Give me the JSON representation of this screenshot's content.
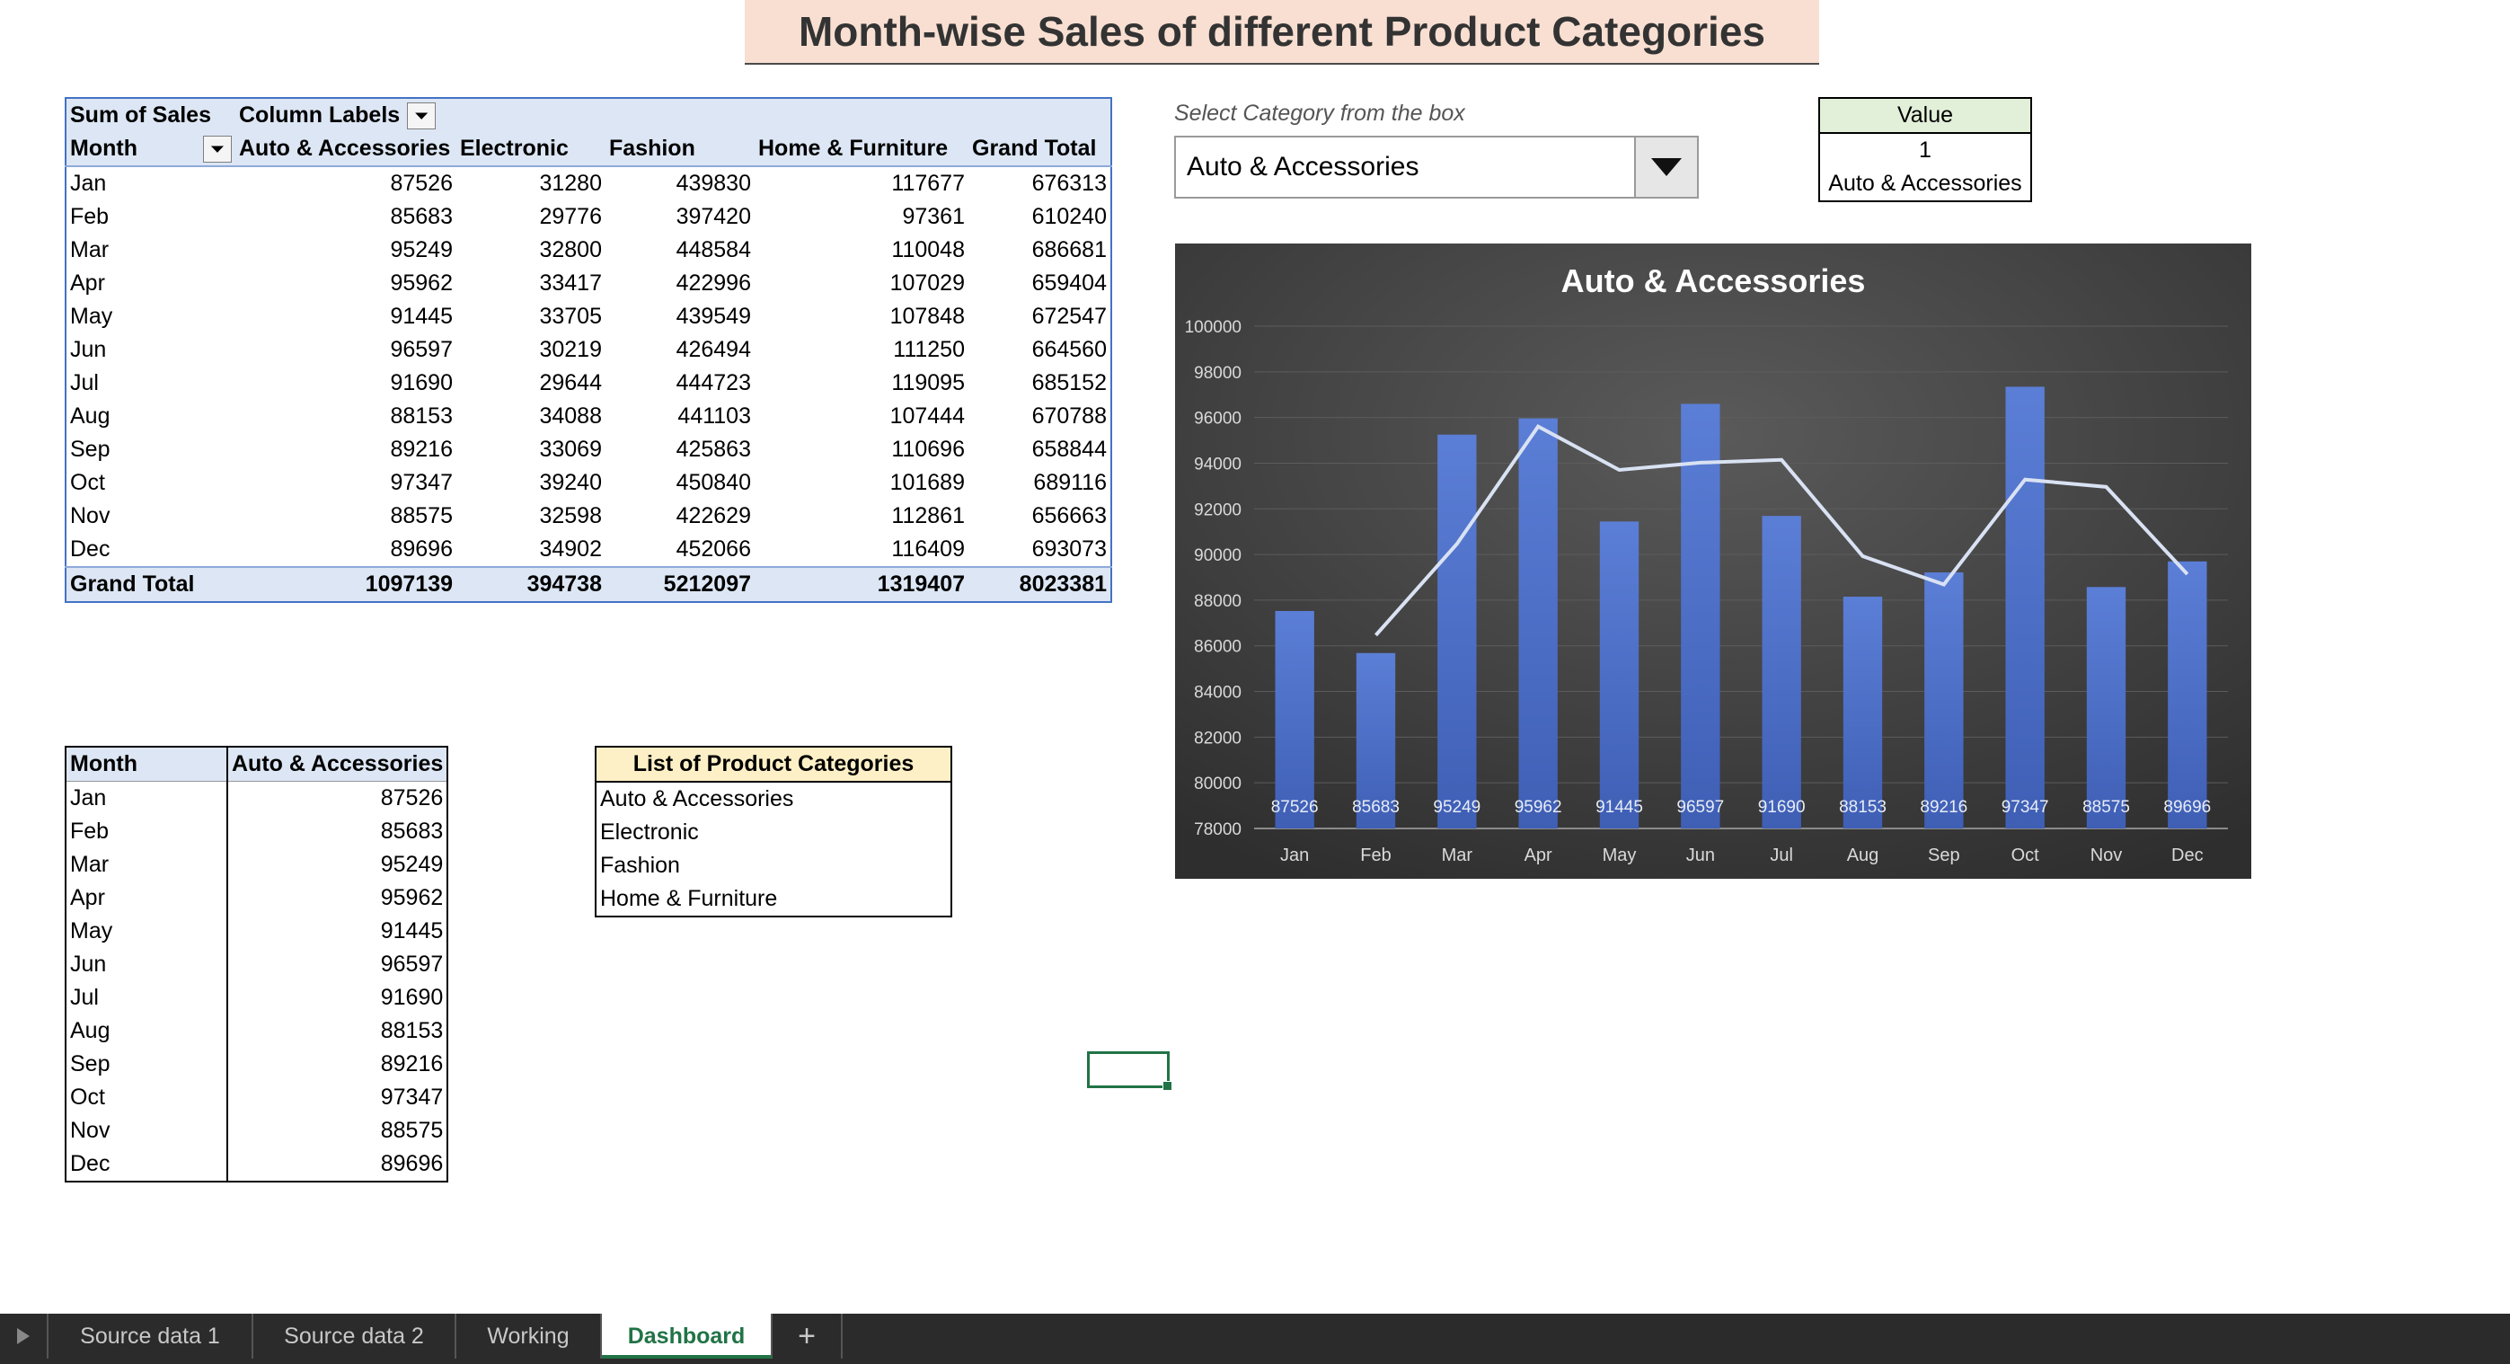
{
  "title": "Month-wise Sales of different Product Categories",
  "pivot": {
    "corner": "Sum of Sales",
    "column_labels": "Column Labels",
    "row_label": "Month",
    "columns": [
      "Auto & Accessories",
      "Electronic",
      "Fashion",
      "Home & Furniture",
      "Grand Total"
    ],
    "rows": [
      {
        "m": "Jan",
        "v": [
          "87526",
          "31280",
          "439830",
          "117677",
          "676313"
        ]
      },
      {
        "m": "Feb",
        "v": [
          "85683",
          "29776",
          "397420",
          "97361",
          "610240"
        ]
      },
      {
        "m": "Mar",
        "v": [
          "95249",
          "32800",
          "448584",
          "110048",
          "686681"
        ]
      },
      {
        "m": "Apr",
        "v": [
          "95962",
          "33417",
          "422996",
          "107029",
          "659404"
        ]
      },
      {
        "m": "May",
        "v": [
          "91445",
          "33705",
          "439549",
          "107848",
          "672547"
        ]
      },
      {
        "m": "Jun",
        "v": [
          "96597",
          "30219",
          "426494",
          "111250",
          "664560"
        ]
      },
      {
        "m": "Jul",
        "v": [
          "91690",
          "29644",
          "444723",
          "119095",
          "685152"
        ]
      },
      {
        "m": "Aug",
        "v": [
          "88153",
          "34088",
          "441103",
          "107444",
          "670788"
        ]
      },
      {
        "m": "Sep",
        "v": [
          "89216",
          "33069",
          "425863",
          "110696",
          "658844"
        ]
      },
      {
        "m": "Oct",
        "v": [
          "97347",
          "39240",
          "450840",
          "101689",
          "689116"
        ]
      },
      {
        "m": "Nov",
        "v": [
          "88575",
          "32598",
          "422629",
          "112861",
          "656663"
        ]
      },
      {
        "m": "Dec",
        "v": [
          "89696",
          "34902",
          "452066",
          "116409",
          "693073"
        ]
      }
    ],
    "total": {
      "m": "Grand Total",
      "v": [
        "1097139",
        "394738",
        "5212097",
        "1319407",
        "8023381"
      ]
    }
  },
  "lower_table": {
    "headers": [
      "Month",
      "Auto & Accessories"
    ],
    "rows": [
      [
        "Jan",
        "87526"
      ],
      [
        "Feb",
        "85683"
      ],
      [
        "Mar",
        "95249"
      ],
      [
        "Apr",
        "95962"
      ],
      [
        "May",
        "91445"
      ],
      [
        "Jun",
        "96597"
      ],
      [
        "Jul",
        "91690"
      ],
      [
        "Aug",
        "88153"
      ],
      [
        "Sep",
        "89216"
      ],
      [
        "Oct",
        "97347"
      ],
      [
        "Nov",
        "88575"
      ],
      [
        "Dec",
        "89696"
      ]
    ]
  },
  "category_list": {
    "header": "List of Product Categories",
    "items": [
      "Auto & Accessories",
      "Electronic",
      "Fashion",
      "Home & Furniture"
    ]
  },
  "selector": {
    "label": "Select Category from the box",
    "value": "Auto & Accessories"
  },
  "value_box": {
    "header": "Value",
    "index": "1",
    "category": "Auto & Accessories"
  },
  "chart_data": {
    "type": "bar",
    "title": "Auto & Accessories",
    "categories": [
      "Jan",
      "Feb",
      "Mar",
      "Apr",
      "May",
      "Jun",
      "Jul",
      "Aug",
      "Sep",
      "Oct",
      "Nov",
      "Dec"
    ],
    "values": [
      87526,
      85683,
      95249,
      95962,
      91445,
      96597,
      91690,
      88153,
      89216,
      97347,
      88575,
      89696
    ],
    "trendline": [
      86466,
      90466,
      95606,
      93704,
      94021,
      94144,
      89922,
      88685,
      93282,
      92961,
      89136
    ],
    "trendline_start_index": 1,
    "ylim": [
      78000,
      100000
    ],
    "yticks": [
      78000,
      80000,
      82000,
      84000,
      86000,
      88000,
      90000,
      92000,
      94000,
      96000,
      98000,
      100000
    ],
    "grid": true,
    "colors": {
      "bar": "#4a6fcc",
      "line": "#d9e2f3",
      "background": "#3f3f3f"
    }
  },
  "sheet_tabs": [
    "Source data 1",
    "Source data 2",
    "Working",
    "Dashboard"
  ],
  "active_tab": "Dashboard",
  "add_sheet": "+"
}
